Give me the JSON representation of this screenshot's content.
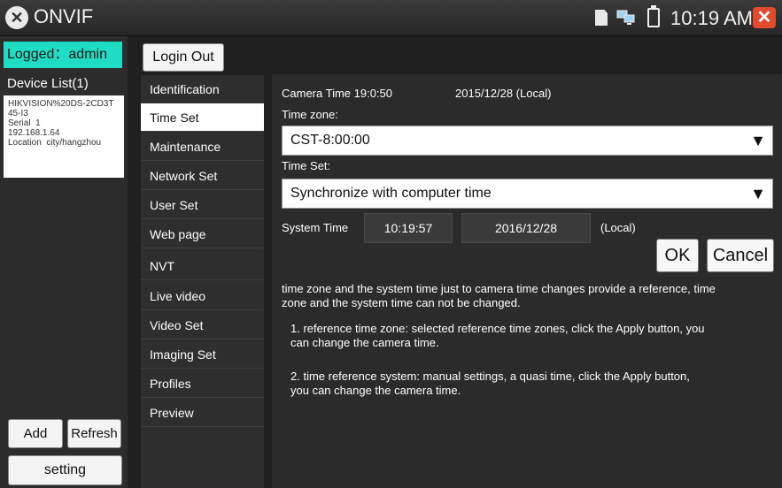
{
  "topbar": {
    "app_title": "ONVIF",
    "clock": "10:19 AM",
    "icons": [
      "tools-icon",
      "sd-card-icon",
      "network-icon",
      "battery-icon",
      "close-icon"
    ]
  },
  "left": {
    "logged": "Logged：admin",
    "device_list_title": "Device List(1)",
    "device": {
      "name": "HIKVISION%20DS-2CD3T",
      "name_cont": "45-I3",
      "serial": "Serial  1",
      "ip": "192.168.1.64",
      "location": "Location  city/hangzhou"
    },
    "add_label": "Add",
    "refresh_label": "Refresh",
    "setting_label": "setting"
  },
  "logout_label": "Login Out",
  "menu": {
    "items": [
      "Identification",
      "Time Set",
      "Maintenance",
      "Network Set",
      "User Set",
      "Web page",
      "NVT",
      "Live video",
      "Video Set",
      "Imaging Set",
      "Profiles",
      "Preview"
    ],
    "active": "Time Set"
  },
  "content": {
    "camera_time_label": "Camera Time 19:0:50",
    "camera_date": "2015/12/28 (Local)",
    "time_zone_label": "Time zone:",
    "time_zone_value": "CST-8:00:00",
    "time_set_label": "Time Set:",
    "time_set_value": "Synchronize with computer time",
    "system_time_label": "System Time",
    "system_time": "10:19:57",
    "system_date": "2016/12/28",
    "local_label": "(Local)",
    "ok_label": "OK",
    "cancel_label": "Cancel",
    "info_main_1": "time zone and the system time just to camera time changes provide a reference, time",
    "info_main_2": "zone and the system time can not be changed.",
    "info_1a": "1. reference time zone: selected reference time zones, click the Apply button, you",
    "info_1b": "can change the camera time.",
    "info_2a": "2. time reference system: manual settings, a quasi time, click the Apply button,",
    "info_2b": "you can change the camera time."
  }
}
